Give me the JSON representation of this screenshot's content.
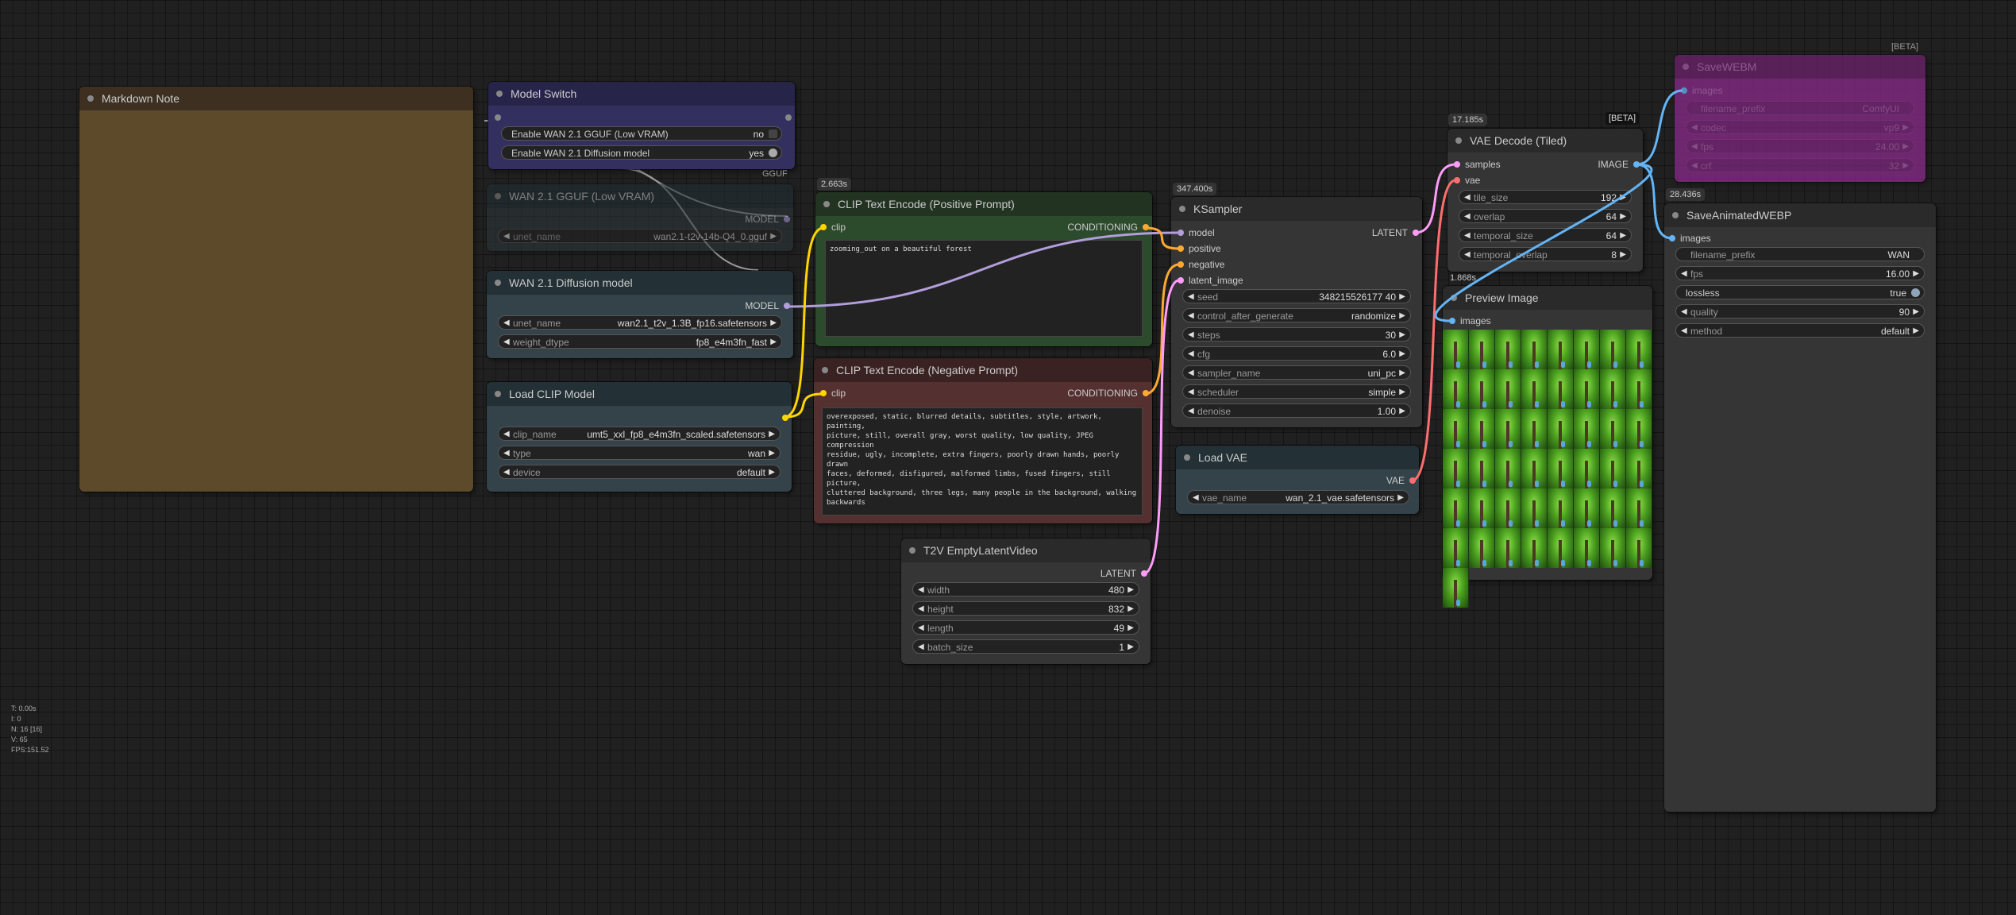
{
  "colors": {
    "canvas_bg": "#202020",
    "node_body": "#353535",
    "node_title": "#2a2a2a",
    "note_body": "#5c4a2b",
    "note_title": "#3d3020",
    "switch_title": "#27244a",
    "switch_body": "#333060",
    "model_title": "#233035",
    "model_body": "#334349",
    "pos_title": "#223322",
    "pos_body": "#2c4a2c",
    "neg_title": "#3a2222",
    "neg_body": "#553030",
    "webm_title": "#6b226b",
    "webm_body": "#8a2b8a",
    "link_model": "#b39ddb",
    "link_clip": "#ffd500",
    "link_conditioning": "#ffa931",
    "link_latent": "#ff9cf9",
    "link_vae": "#ff6e6e",
    "link_image": "#64b5f6"
  },
  "stats": {
    "t": "T: 0.00s",
    "i": "I: 0",
    "n": "N: 16 [16]",
    "v": "V: 65",
    "fps": "FPS:151.52"
  },
  "markdown_note": {
    "title": "Markdown Note"
  },
  "model_switch": {
    "title": "Model Switch",
    "toggles": [
      {
        "label": "Enable WAN 2.1 GGUF (Low VRAM)",
        "value": "no"
      },
      {
        "label": "Enable WAN 2.1 Diffusion model",
        "value": "yes"
      }
    ],
    "group_label": "GGUF"
  },
  "gguf_loader": {
    "title": "WAN 2.1 GGUF (Low VRAM)",
    "output": "MODEL",
    "widgets": [
      {
        "label": "unet_name",
        "value": "wan2.1-t2v-14b-Q4_0.gguf"
      }
    ]
  },
  "diffusion_loader": {
    "title": "WAN 2.1 Diffusion model",
    "output": "MODEL",
    "widgets": [
      {
        "label": "unet_name",
        "value": "wan2.1_t2v_1.3B_fp16.safetensors"
      },
      {
        "label": "weight_dtype",
        "value": "fp8_e4m3fn_fast"
      }
    ]
  },
  "load_clip": {
    "title": "Load CLIP Model",
    "widgets": [
      {
        "label": "clip_name",
        "value": "umt5_xxl_fp8_e4m3fn_scaled.safetensors"
      },
      {
        "label": "type",
        "value": "wan"
      },
      {
        "label": "device",
        "value": "default"
      }
    ]
  },
  "clip_pos": {
    "badge": "2.663s",
    "title": "CLIP Text Encode (Positive Prompt)",
    "input": "clip",
    "output": "CONDITIONING",
    "text": "zooming_out on a beautiful forest"
  },
  "clip_neg": {
    "title": "CLIP Text Encode (Negative Prompt)",
    "input": "clip",
    "output": "CONDITIONING",
    "text": "overexposed, static, blurred details, subtitles, style, artwork, painting,\npicture, still, overall gray, worst quality, low quality, JPEG compression\nresidue, ugly, incomplete, extra fingers, poorly drawn hands, poorly drawn\nfaces, deformed, disfigured, malformed limbs, fused fingers, still picture,\ncluttered background, three legs, many people in the background, walking\nbackwards"
  },
  "empty_latent": {
    "title": "T2V EmptyLatentVideo",
    "output": "LATENT",
    "widgets": [
      {
        "label": "width",
        "value": "480"
      },
      {
        "label": "height",
        "value": "832"
      },
      {
        "label": "length",
        "value": "49"
      },
      {
        "label": "batch_size",
        "value": "1"
      }
    ]
  },
  "ksampler": {
    "badge": "347.400s",
    "title": "KSampler",
    "inputs": [
      "model",
      "positive",
      "negative",
      "latent_image"
    ],
    "output": "LATENT",
    "widgets": [
      {
        "label": "seed",
        "value": "348215526177 40"
      },
      {
        "label": "control_after_generate",
        "value": "randomize"
      },
      {
        "label": "steps",
        "value": "30"
      },
      {
        "label": "cfg",
        "value": "6.0"
      },
      {
        "label": "sampler_name",
        "value": "uni_pc"
      },
      {
        "label": "scheduler",
        "value": "simple"
      },
      {
        "label": "denoise",
        "value": "1.00"
      }
    ]
  },
  "load_vae": {
    "title": "Load VAE",
    "output": "VAE",
    "widgets": [
      {
        "label": "vae_name",
        "value": "wan_2.1_vae.safetensors"
      }
    ]
  },
  "vae_decode": {
    "badge": "17.185s",
    "beta": "[BETA]",
    "title": "VAE Decode (Tiled)",
    "inputs": [
      "samples",
      "vae"
    ],
    "output": "IMAGE",
    "widgets": [
      {
        "label": "tile_size",
        "value": "192"
      },
      {
        "label": "overlap",
        "value": "64"
      },
      {
        "label": "temporal_size",
        "value": "64"
      },
      {
        "label": "temporal_overlap",
        "value": "8"
      }
    ]
  },
  "preview": {
    "badge": "1.868s",
    "title": "Preview Image",
    "input": "images",
    "frames": 49
  },
  "save_webm": {
    "beta": "[BETA]",
    "title": "SaveWEBM",
    "input": "images",
    "widgets": [
      {
        "label": "filename_prefix",
        "value": "ComfyUI"
      },
      {
        "label": "codec",
        "value": "vp9"
      },
      {
        "label": "fps",
        "value": "24.00"
      },
      {
        "label": "crf",
        "value": "32"
      }
    ]
  },
  "save_webp": {
    "badge": "28.436s",
    "title": "SaveAnimatedWEBP",
    "input": "images",
    "widgets": [
      {
        "label": "filename_prefix",
        "value": "WAN"
      },
      {
        "label": "fps",
        "value": "16.00"
      },
      {
        "label": "lossless",
        "value": "true"
      },
      {
        "label": "quality",
        "value": "90"
      },
      {
        "label": "method",
        "value": "default"
      }
    ]
  }
}
